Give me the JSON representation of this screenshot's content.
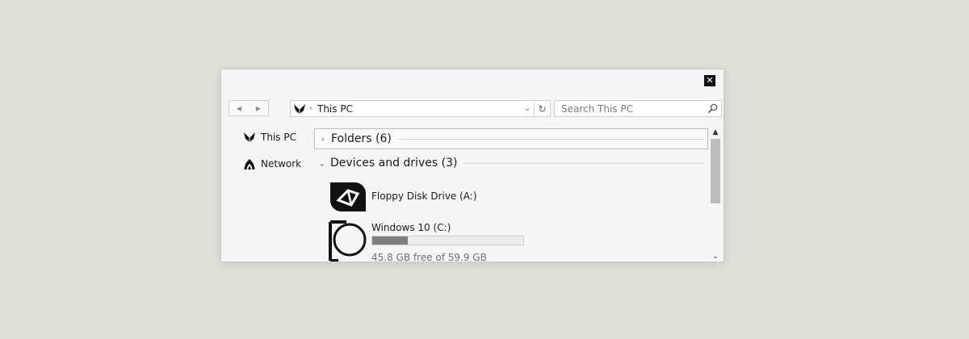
{
  "window": {
    "close_glyph": "✕"
  },
  "nav": {
    "back_glyph": "◀",
    "forward_glyph": "▶"
  },
  "address": {
    "icon": "this-pc-icon",
    "separator": "›",
    "path": "This PC",
    "dropdown_glyph": "⌄",
    "refresh_glyph": "↻"
  },
  "search": {
    "placeholder": "Search This PC",
    "icon": "search-icon"
  },
  "sidebar": {
    "items": [
      {
        "label": "This PC",
        "icon": "this-pc-icon"
      },
      {
        "label": "Network",
        "icon": "network-icon"
      }
    ]
  },
  "groups": {
    "folders": {
      "label": "Folders (6)",
      "chevron": "›",
      "expanded": false
    },
    "devices": {
      "label": "Devices and drives (3)",
      "chevron": "⌄",
      "expanded": true
    }
  },
  "drives": [
    {
      "name": "Floppy Disk Drive (A:)",
      "icon": "floppy-drive-icon"
    },
    {
      "name": "Windows 10 (C:)",
      "icon": "hard-drive-icon",
      "free_text": "45.8 GB free of 59.9 GB",
      "used_fraction": 0.235
    }
  ],
  "scrollbar": {
    "up_glyph": "▲",
    "down_glyph": "⌄"
  },
  "colors": {
    "desktop": "#dfdfd8",
    "window_bg": "#f5f5f5",
    "bar_fill": "#7f7f7f",
    "scroll_thumb": "#bcbcbc"
  }
}
